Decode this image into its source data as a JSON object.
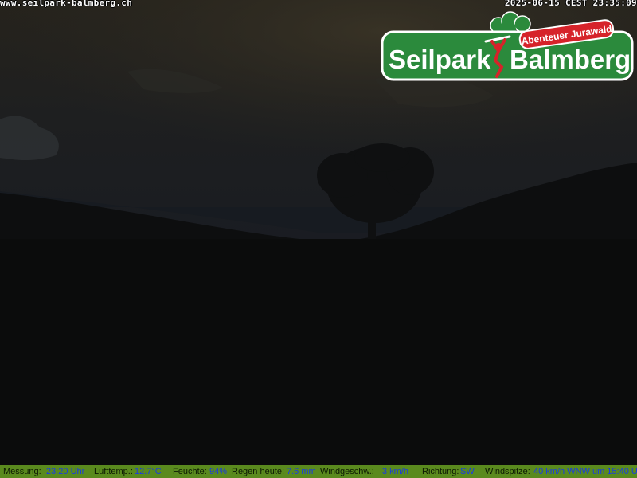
{
  "overlay": {
    "url": "www.seilpark-balmberg.ch",
    "timestamp": "2025-06-15 CEST 23:35:09"
  },
  "logo": {
    "tagline": "Abenteuer Jurawald",
    "name_left": "Seilpark",
    "name_right": "Balmberg"
  },
  "weather": {
    "measurement_label": "Messung:",
    "measurement_value": "23:20 Uhr",
    "temp_label": "Lufttemp.:",
    "temp_value": "12.7°C",
    "humidity_label": "Feuchte:",
    "humidity_value": "94%",
    "rain_label": "Regen heute:",
    "rain_value": "7.6 mm",
    "wind_speed_label": "Windgeschw.:",
    "wind_speed_value": "3 km/h",
    "direction_label": "Richtung:",
    "direction_value": "SW",
    "gust_label": "Windspitze:",
    "gust_value": "40 km/h WNW um 15:40 U"
  },
  "colors": {
    "logo_green": "#2b8a3c",
    "logo_red": "#d6232a",
    "bar_green": "#5a8a1e",
    "value_blue": "#1a3ce0"
  }
}
